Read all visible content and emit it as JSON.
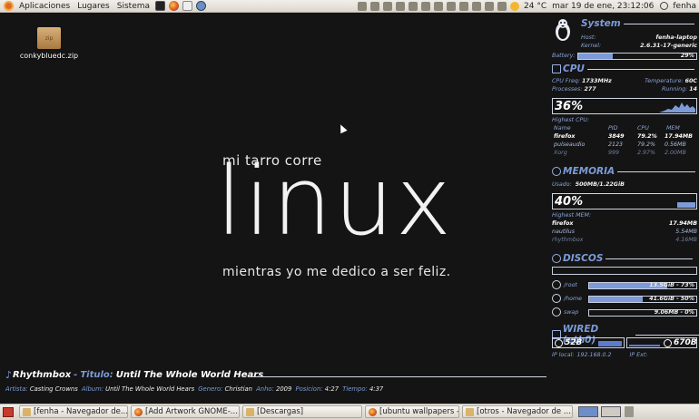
{
  "top_panel": {
    "menus": [
      "Aplicaciones",
      "Lugares",
      "Sistema"
    ],
    "weather": "24 °C",
    "datetime": "mar 19 de ene, 23:12:06",
    "user": "fenha"
  },
  "desktop": {
    "icon_badge": "zip",
    "icon_label": "conkybluedc.zip",
    "wallpaper": {
      "line1": "mi tarro corre",
      "big": "linux",
      "line3": "mientras yo me dedico a ser feliz."
    }
  },
  "conky": {
    "system": {
      "title": "System",
      "host_label": "Host:",
      "host": "fenha-laptop",
      "kernel_label": "Kernel:",
      "kernel": "2.6.31-17-generic",
      "battery_label": "Battery:",
      "battery": "29%",
      "battery_level": 0.29
    },
    "cpu": {
      "title": "CPU",
      "freq_label": "CPU Freq:",
      "freq": "1733MHz",
      "temp_label": "Temperature:",
      "temp": "60C",
      "proc_label": "Processes:",
      "proc": "277",
      "running_label": "Running:",
      "running": "14",
      "usage": "36%",
      "highest_label": "Highest CPU:",
      "headers": [
        "Name",
        "PID",
        "CPU",
        "MEM"
      ],
      "rows": [
        [
          "firefox",
          "3849",
          "79.2%",
          "17.94MB"
        ],
        [
          "pulseaudio",
          "2123",
          "79.2%",
          "0.56MB"
        ],
        [
          "Xorg",
          "999",
          "2.97%",
          "2.00MB"
        ]
      ]
    },
    "memoria": {
      "title": "MEMORIA",
      "used_label": "Usado:",
      "used": "500MB/1.22GiB",
      "usage": "40%",
      "highest_label": "Highest MEM:",
      "rows": [
        [
          "firefox",
          "17.94MB"
        ],
        [
          "nautilus",
          "5.54MB"
        ],
        [
          "rhythmbox",
          "4.16MB"
        ]
      ]
    },
    "discos": {
      "title": "DISCOS",
      "items": [
        {
          "name": "/root",
          "value": "13.5GiB - 73%",
          "level": 0.73
        },
        {
          "name": "/home",
          "value": "41.6GiB - 50%",
          "level": 0.5
        },
        {
          "name": "swap",
          "value": "9.06MB - 0%",
          "level": 0.0
        }
      ]
    },
    "wired": {
      "title": "WIRED (eth0)",
      "down": "52B",
      "up": "670B",
      "ip_label": "IP local:",
      "ip": "192.168.0.2",
      "ext_label": "IP Ext:"
    }
  },
  "rhythmbox": {
    "app": "Rhythmbox",
    "title_label": "Titulo:",
    "title": "Until The Whole World Hears",
    "artist_label": "Artista:",
    "artist": "Casting Crowns",
    "album_label": "Album:",
    "album": "Until The Whole World Hears",
    "genre_label": "Genero:",
    "genre": "Christian",
    "year_label": "Anho:",
    "year": "2009",
    "pos_label": "Posicion:",
    "pos": "4:27",
    "time_label": "Tiempo:",
    "time": "4:37"
  },
  "taskbar": {
    "tasks": [
      {
        "label": "[fenha - Navegador de...",
        "icon": "folder"
      },
      {
        "label": "[Add Artwork GNOME-...",
        "icon": "firefox"
      },
      {
        "label": "[Descargas]",
        "icon": "folder"
      },
      {
        "label": "[ubuntu wallpapers - N...",
        "icon": "firefox"
      },
      {
        "label": "[otros - Navegador de ...",
        "icon": "folder"
      }
    ]
  }
}
